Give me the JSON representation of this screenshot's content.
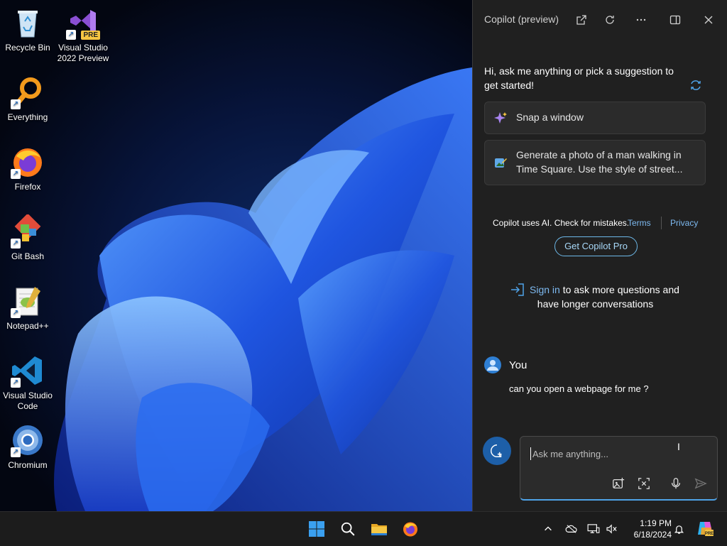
{
  "desktop": {
    "icons": [
      {
        "label": "Recycle Bin",
        "icon": "recycle-bin-icon"
      },
      {
        "label": "Visual Studio 2022 Preview",
        "icon": "visual-studio-icon",
        "badge": "PRE"
      },
      {
        "label": "Everything",
        "icon": "everything-search-icon"
      },
      {
        "label": "Firefox",
        "icon": "firefox-icon"
      },
      {
        "label": "Git Bash",
        "icon": "git-bash-icon"
      },
      {
        "label": "Notepad++",
        "icon": "notepad-plus-plus-icon"
      },
      {
        "label": "Visual Studio Code",
        "icon": "vscode-icon"
      },
      {
        "label": "Chromium",
        "icon": "chromium-icon"
      }
    ]
  },
  "copilot": {
    "title": "Copilot (preview)",
    "greeting": "Hi, ask me anything or pick a suggestion to get started!",
    "suggestions": [
      {
        "text": "Snap a window",
        "icon": "sparkle-icon"
      },
      {
        "text": "Generate a photo of a man walking in Time Square. Use the style of street...",
        "icon": "image-pen-icon"
      }
    ],
    "disclaimer": "Copilot uses AI. Check for mistakes.",
    "terms_label": "Terms",
    "privacy_label": "Privacy",
    "get_pro_label": "Get Copilot Pro",
    "signin_link": "Sign in",
    "signin_rest": " to ask more questions and",
    "signin_line2": "have longer conversations",
    "you_label": "You",
    "user_message": "can you open a webpage for me ?",
    "input_placeholder": "Ask me anything..."
  },
  "taskbar": {
    "time": "1:19 PM",
    "date": "6/18/2024"
  },
  "colors": {
    "accent": "#4fa3e8",
    "link": "#7db9f0",
    "panel_bg": "#202020"
  }
}
